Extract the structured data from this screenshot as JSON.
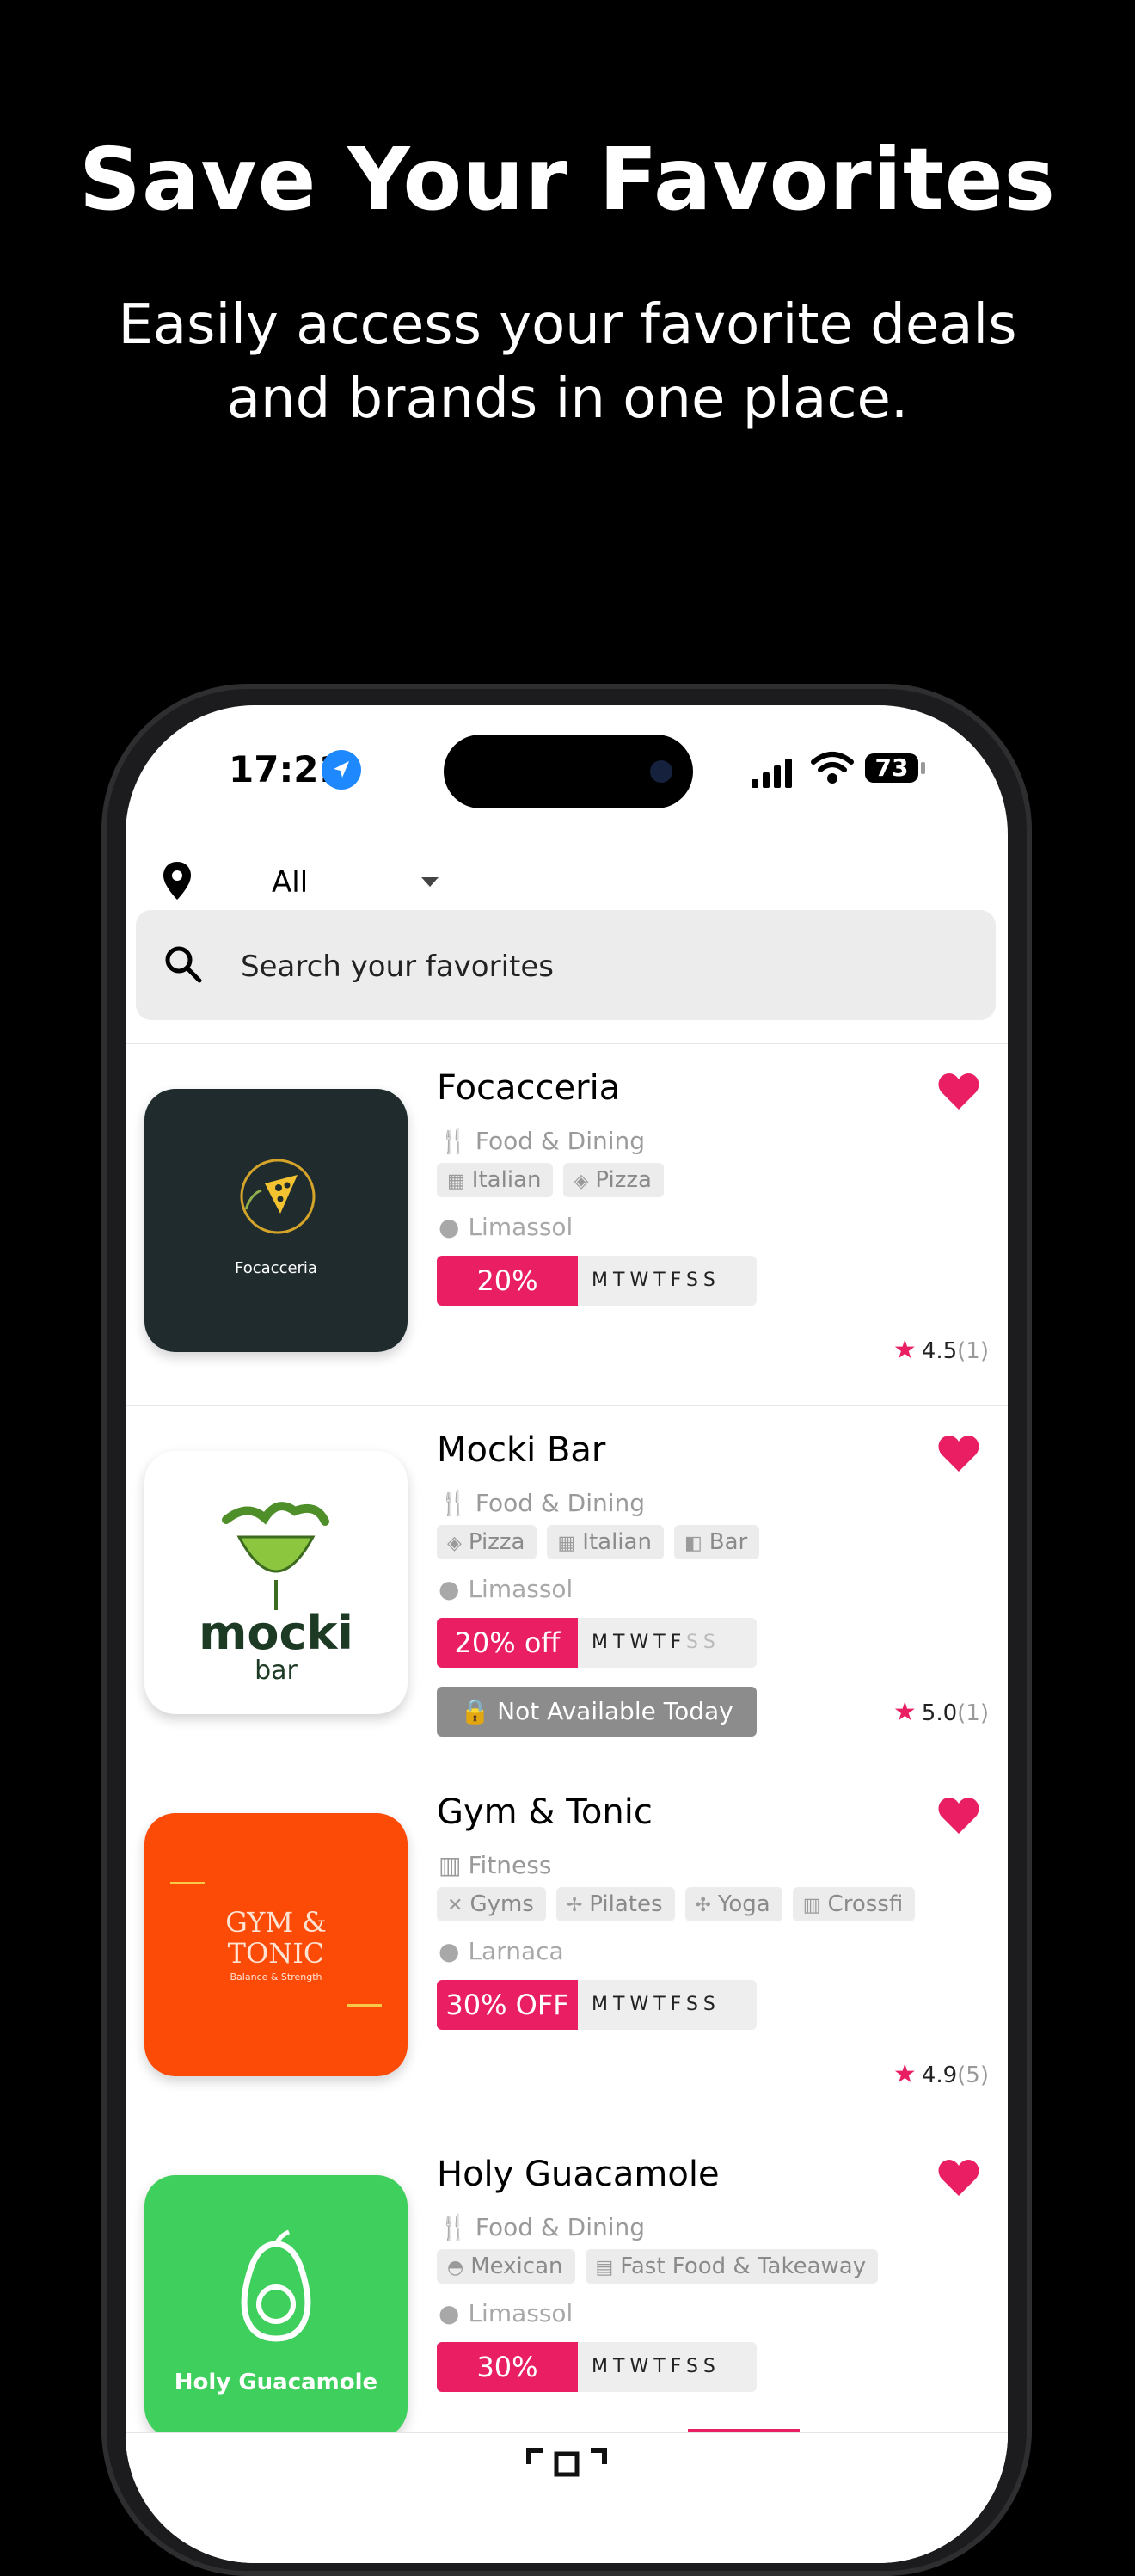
{
  "promo": {
    "title": "Save Your Favorites",
    "subtitle_line1": "Easily access your favorite deals",
    "subtitle_line2": "and brands in one place."
  },
  "status_bar": {
    "time": "17:21",
    "battery": "73"
  },
  "filter": {
    "label": "All"
  },
  "search": {
    "placeholder": "Search your favorites"
  },
  "colors": {
    "accent": "#e91e63",
    "background": "#000000"
  },
  "favorites": [
    {
      "name": "Focacceria",
      "category": "Food & Dining",
      "tags": [
        "Italian",
        "Pizza"
      ],
      "city": "Limassol",
      "deal": "20%",
      "days": [
        "M",
        "T",
        "W",
        "T",
        "F",
        "S",
        "S"
      ],
      "rating": "4.5",
      "rating_count": "(1)",
      "logo_text": "Focacceria"
    },
    {
      "name": "Mocki Bar",
      "category": "Food & Dining",
      "tags": [
        "Pizza",
        "Italian",
        "Bar"
      ],
      "city": "Limassol",
      "deal": "20% off",
      "days": [
        "M",
        "T",
        "W",
        "T",
        "F",
        "S",
        "S"
      ],
      "availability": "Not Available Today",
      "rating": "5.0",
      "rating_count": "(1)",
      "logo_text": "mocki",
      "logo_subtext": "bar"
    },
    {
      "name": "Gym & Tonic",
      "category": "Fitness",
      "tags": [
        "Gyms",
        "Pilates",
        "Yoga",
        "Crossfi"
      ],
      "city": "Larnaca",
      "deal": "30% OFF",
      "days": [
        "M",
        "T",
        "W",
        "T",
        "F",
        "S",
        "S"
      ],
      "rating": "4.9",
      "rating_count": "(5)",
      "logo_text": "GYM &",
      "logo_text2": "TONIC",
      "logo_subtext": "Balance & Strength"
    },
    {
      "name": "Holy Guacamole",
      "category": "Food & Dining",
      "tags": [
        "Mexican",
        "Fast Food & Takeaway"
      ],
      "city": "Limassol",
      "deal": "30%",
      "days": [
        "M",
        "T",
        "W",
        "T",
        "F",
        "S",
        "S"
      ],
      "logo_text": "Holy Guacamole"
    }
  ]
}
